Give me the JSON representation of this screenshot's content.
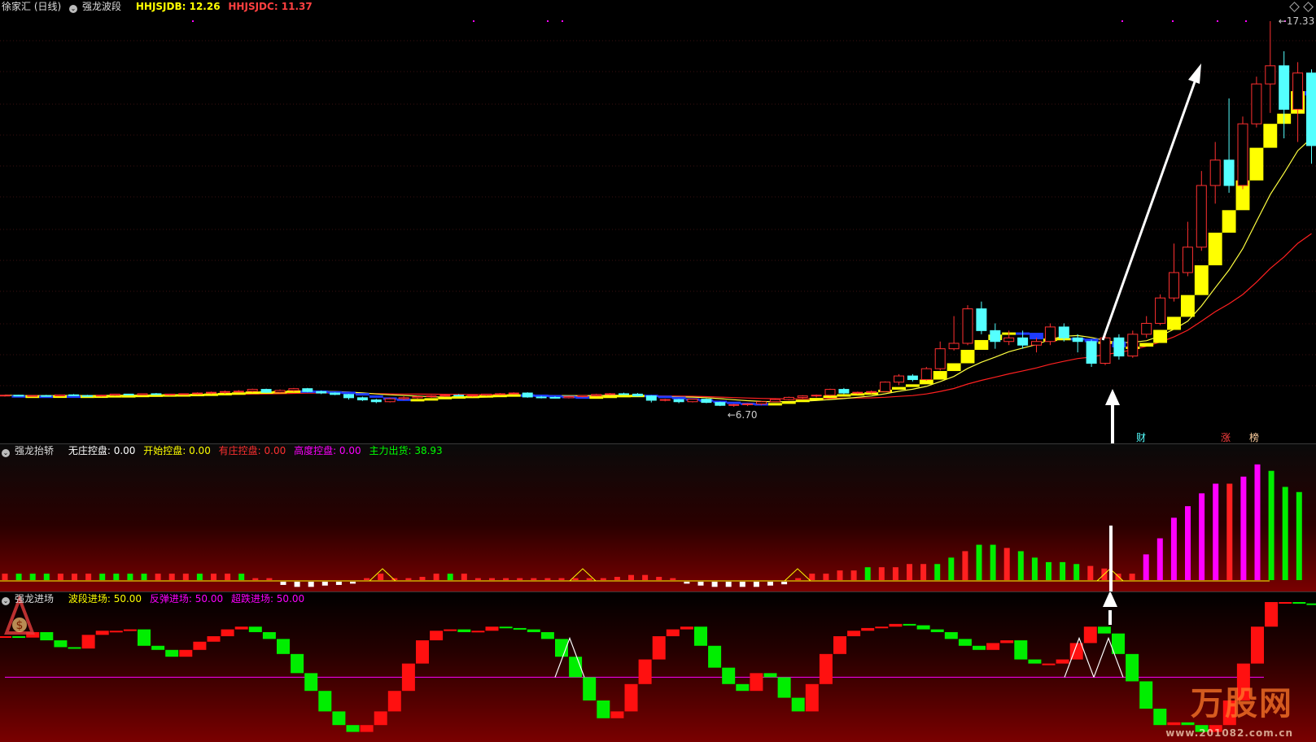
{
  "header_main": {
    "stock": "徐家汇 (日线)",
    "indicator": "强龙波段",
    "label1": "HHJSJDB: 12.26",
    "label2": "HHJSJDC: 11.37"
  },
  "header_p2": {
    "title": "强龙抬轿",
    "items": [
      "无庄控盘: 0.00",
      "开始控盘: 0.00",
      "有庄控盘: 0.00",
      "高度控盘: 0.00",
      "主力出货: 38.93"
    ]
  },
  "header_p3": {
    "title": "强龙进场",
    "items": [
      "波段进场: 50.00",
      "反弹进场: 50.00",
      "超跌进场: 50.00"
    ]
  },
  "markers": [
    "财",
    "涨",
    "榜"
  ],
  "watermark": {
    "brand": "万股网",
    "url": "www.201082.com.cn"
  },
  "colors": {
    "up": "#ff3030",
    "down": "#54ffff",
    "ma": "#ffff00",
    "magenta": "#ff00ff",
    "green": "#00ff00"
  },
  "chart_data": [
    {
      "type": "candlestick",
      "title": "强龙波段",
      "annotations": [
        {
          "text": "17.33",
          "kind": "max_price"
        },
        {
          "text": "6.70",
          "kind": "min_price"
        }
      ],
      "candles": [
        [
          7.0,
          7.03,
          6.98,
          7.02
        ],
        [
          7.02,
          7.03,
          6.99,
          7.0
        ],
        [
          7.0,
          7.02,
          6.99,
          7.01
        ],
        [
          7.01,
          7.03,
          6.98,
          7.0
        ],
        [
          7.0,
          7.04,
          6.99,
          7.03
        ],
        [
          7.03,
          7.05,
          7.0,
          7.01
        ],
        [
          7.01,
          7.03,
          6.98,
          7.0
        ],
        [
          7.0,
          7.03,
          6.98,
          7.02
        ],
        [
          7.02,
          7.06,
          7.0,
          7.05
        ],
        [
          7.05,
          7.06,
          7.02,
          7.03
        ],
        [
          7.03,
          7.07,
          7.02,
          7.06
        ],
        [
          7.06,
          7.08,
          7.03,
          7.04
        ],
        [
          7.04,
          7.06,
          7.01,
          7.05
        ],
        [
          7.05,
          7.07,
          7.03,
          7.06
        ],
        [
          7.06,
          7.1,
          7.04,
          7.08
        ],
        [
          7.08,
          7.12,
          7.05,
          7.1
        ],
        [
          7.1,
          7.15,
          7.06,
          7.12
        ],
        [
          7.12,
          7.16,
          7.1,
          7.13
        ],
        [
          7.13,
          7.2,
          7.1,
          7.18
        ],
        [
          7.18,
          7.2,
          7.08,
          7.1
        ],
        [
          7.1,
          7.18,
          7.08,
          7.15
        ],
        [
          7.15,
          7.22,
          7.12,
          7.2
        ],
        [
          7.2,
          7.22,
          7.1,
          7.12
        ],
        [
          7.12,
          7.15,
          7.05,
          7.08
        ],
        [
          7.08,
          7.1,
          7.02,
          7.04
        ],
        [
          7.04,
          7.06,
          6.9,
          6.95
        ],
        [
          6.95,
          6.98,
          6.86,
          6.89
        ],
        [
          6.89,
          6.92,
          6.8,
          6.84
        ],
        [
          6.84,
          6.95,
          6.82,
          6.92
        ],
        [
          6.92,
          6.99,
          6.88,
          6.95
        ],
        [
          6.95,
          7.0,
          6.92,
          6.98
        ],
        [
          6.98,
          7.02,
          6.95,
          7.0
        ],
        [
          7.0,
          7.04,
          6.97,
          7.02
        ],
        [
          7.02,
          7.05,
          6.99,
          7.01
        ],
        [
          7.01,
          7.03,
          6.98,
          7.02
        ],
        [
          7.02,
          7.06,
          7.0,
          7.05
        ],
        [
          7.05,
          7.08,
          7.02,
          7.06
        ],
        [
          7.06,
          7.1,
          7.04,
          7.08
        ],
        [
          7.08,
          7.1,
          6.95,
          6.97
        ],
        [
          6.97,
          7.0,
          6.93,
          6.96
        ],
        [
          6.96,
          6.99,
          6.93,
          6.95
        ],
        [
          6.95,
          7.0,
          6.93,
          6.98
        ],
        [
          6.98,
          7.02,
          6.96,
          7.01
        ],
        [
          7.01,
          7.06,
          6.99,
          7.04
        ],
        [
          7.04,
          7.08,
          7.02,
          7.06
        ],
        [
          7.06,
          7.09,
          7.03,
          7.05
        ],
        [
          7.05,
          7.08,
          6.98,
          7.0
        ],
        [
          7.0,
          7.02,
          6.82,
          6.88
        ],
        [
          6.88,
          6.92,
          6.85,
          6.9
        ],
        [
          6.9,
          6.92,
          6.8,
          6.84
        ],
        [
          6.84,
          6.92,
          6.82,
          6.91
        ],
        [
          6.91,
          6.93,
          6.8,
          6.82
        ],
        [
          6.82,
          6.84,
          6.72,
          6.74
        ],
        [
          6.74,
          6.78,
          6.7,
          6.76
        ],
        [
          6.76,
          6.8,
          6.72,
          6.78
        ],
        [
          6.78,
          6.86,
          6.74,
          6.84
        ],
        [
          6.84,
          6.92,
          6.82,
          6.9
        ],
        [
          6.9,
          6.98,
          6.88,
          6.96
        ],
        [
          6.96,
          7.02,
          6.93,
          7.0
        ],
        [
          7.0,
          7.04,
          6.96,
          7.02
        ],
        [
          7.02,
          7.2,
          7.0,
          7.18
        ],
        [
          7.18,
          7.22,
          7.05,
          7.08
        ],
        [
          7.08,
          7.12,
          7.05,
          7.1
        ],
        [
          7.1,
          7.15,
          7.06,
          7.12
        ],
        [
          7.12,
          7.4,
          7.1,
          7.38
        ],
        [
          7.38,
          7.6,
          7.3,
          7.55
        ],
        [
          7.55,
          7.6,
          7.4,
          7.45
        ],
        [
          7.45,
          7.8,
          7.42,
          7.75
        ],
        [
          7.75,
          8.5,
          7.7,
          8.3
        ],
        [
          8.3,
          9.2,
          8.25,
          8.45
        ],
        [
          8.45,
          9.5,
          8.4,
          9.4
        ],
        [
          9.4,
          9.6,
          8.7,
          8.8
        ],
        [
          8.8,
          9.0,
          8.3,
          8.5
        ],
        [
          8.5,
          8.8,
          8.4,
          8.6
        ],
        [
          8.6,
          8.8,
          8.3,
          8.4
        ],
        [
          8.4,
          8.6,
          8.2,
          8.5
        ],
        [
          8.5,
          9.0,
          8.4,
          8.9
        ],
        [
          8.9,
          9.0,
          8.5,
          8.6
        ],
        [
          8.6,
          8.7,
          8.2,
          8.5
        ],
        [
          8.5,
          8.55,
          7.8,
          7.9
        ],
        [
          7.9,
          8.7,
          7.85,
          8.6
        ],
        [
          8.6,
          8.7,
          8.0,
          8.1
        ],
        [
          8.1,
          8.8,
          8.05,
          8.7
        ],
        [
          8.7,
          9.2,
          8.6,
          9.0
        ],
        [
          9.0,
          9.8,
          8.95,
          9.7
        ],
        [
          9.7,
          11.2,
          9.6,
          10.4
        ],
        [
          10.4,
          11.8,
          10.3,
          11.1
        ],
        [
          11.1,
          13.2,
          11.0,
          12.8
        ],
        [
          12.8,
          14.0,
          12.3,
          13.5
        ],
        [
          13.5,
          15.2,
          12.6,
          12.8
        ],
        [
          12.8,
          14.7,
          12.7,
          14.5
        ],
        [
          14.5,
          15.8,
          14.4,
          15.6
        ],
        [
          15.6,
          17.33,
          14.8,
          16.1
        ],
        [
          16.1,
          16.5,
          14.1,
          14.9
        ],
        [
          14.9,
          16.2,
          14.0,
          15.9
        ],
        [
          15.9,
          16.0,
          13.4,
          13.9
        ]
      ],
      "ma_thin_yellow": [
        8.7,
        9.1,
        9.6,
        10.1,
        10.7,
        11.3,
        11.9,
        12.4,
        12.9,
        13.2
      ],
      "ma_thin_red": [
        8.4,
        8.55,
        8.8,
        9.1,
        9.5,
        9.9,
        10.4,
        10.9,
        11.5,
        12.0
      ]
    },
    {
      "type": "bar",
      "title": "强龙抬轿",
      "series": [
        {
          "name": "主力出货",
          "values": [
            38.93
          ]
        }
      ],
      "bars": [
        [
          1,
          "r"
        ],
        [
          1,
          "g"
        ],
        [
          1,
          "g"
        ],
        [
          1,
          "g"
        ],
        [
          1,
          "r"
        ],
        [
          1,
          "r"
        ],
        [
          1,
          "r"
        ],
        [
          1,
          "g"
        ],
        [
          1,
          "g"
        ],
        [
          1,
          "g"
        ],
        [
          1,
          "g"
        ],
        [
          1,
          "r"
        ],
        [
          1,
          "r"
        ],
        [
          1,
          "r"
        ],
        [
          1,
          "g"
        ],
        [
          1,
          "r"
        ],
        [
          1,
          "r"
        ],
        [
          1,
          "g"
        ],
        [
          0.3,
          "r"
        ],
        [
          0.3,
          "r"
        ],
        [
          -0.5,
          "w"
        ],
        [
          -0.8,
          "w"
        ],
        [
          -0.8,
          "w"
        ],
        [
          -0.6,
          "w"
        ],
        [
          -0.5,
          "w"
        ],
        [
          -0.3,
          "w"
        ],
        [
          0.3,
          "r"
        ],
        [
          1,
          "r"
        ],
        [
          0.3,
          "r"
        ],
        [
          0.3,
          "r"
        ],
        [
          0.5,
          "r"
        ],
        [
          1,
          "r"
        ],
        [
          1,
          "g"
        ],
        [
          1,
          "r"
        ],
        [
          0.3,
          "r"
        ],
        [
          0.3,
          "r"
        ],
        [
          0.3,
          "r"
        ],
        [
          0.3,
          "r"
        ],
        [
          0.3,
          "r"
        ],
        [
          0.3,
          "r"
        ],
        [
          0.3,
          "r"
        ],
        [
          0.3,
          "r"
        ],
        [
          0.3,
          "r"
        ],
        [
          0.3,
          "r"
        ],
        [
          0.5,
          "r"
        ],
        [
          0.8,
          "r"
        ],
        [
          0.8,
          "r"
        ],
        [
          0.5,
          "r"
        ],
        [
          0.3,
          "r"
        ],
        [
          -0.3,
          "w"
        ],
        [
          -0.6,
          "w"
        ],
        [
          -0.8,
          "w"
        ],
        [
          -0.8,
          "w"
        ],
        [
          -0.8,
          "w"
        ],
        [
          -0.8,
          "w"
        ],
        [
          -0.6,
          "w"
        ],
        [
          -0.4,
          "w"
        ],
        [
          0.3,
          "r"
        ],
        [
          1,
          "r"
        ],
        [
          1,
          "r"
        ],
        [
          1.5,
          "r"
        ],
        [
          1.5,
          "r"
        ],
        [
          2,
          "g"
        ],
        [
          2,
          "r"
        ],
        [
          2,
          "r"
        ],
        [
          2.5,
          "r"
        ],
        [
          2.5,
          "r"
        ],
        [
          2.5,
          "g"
        ],
        [
          3.5,
          "g"
        ],
        [
          4.5,
          "r"
        ],
        [
          5.5,
          "g"
        ],
        [
          5.5,
          "g"
        ],
        [
          5,
          "r"
        ],
        [
          4.5,
          "g"
        ],
        [
          3.5,
          "g"
        ],
        [
          2.8,
          "g"
        ],
        [
          2.8,
          "g"
        ],
        [
          2.5,
          "g"
        ],
        [
          2.2,
          "r"
        ],
        [
          1.8,
          "r"
        ],
        [
          1,
          "r"
        ],
        [
          1,
          "r"
        ],
        [
          4,
          "m"
        ],
        [
          6.5,
          "m"
        ],
        [
          9.7,
          "m"
        ],
        [
          11.5,
          "m"
        ],
        [
          13.5,
          "m"
        ],
        [
          15,
          "m"
        ],
        [
          15,
          "r"
        ],
        [
          16.1,
          "m"
        ],
        [
          18,
          "m"
        ],
        [
          17,
          "g"
        ],
        [
          14.5,
          "g"
        ],
        [
          13.7,
          "g"
        ]
      ]
    },
    {
      "type": "line",
      "title": "强龙进场",
      "series": [
        {
          "name": "波段进场",
          "values": [
            50.0
          ]
        },
        {
          "name": "反弹进场",
          "values": [
            50.0
          ]
        },
        {
          "name": "超跌进场",
          "values": [
            50.0
          ]
        }
      ],
      "values": [
        75,
        74,
        78,
        72,
        67,
        66,
        76,
        79,
        79,
        80,
        68,
        65,
        60,
        65,
        71,
        75,
        80,
        82,
        78,
        73,
        62,
        48,
        35,
        20,
        10,
        5,
        10,
        20,
        35,
        55,
        72,
        79,
        80,
        78,
        79,
        82,
        81,
        80,
        78,
        73,
        60,
        45,
        28,
        15,
        20,
        40,
        58,
        75,
        80,
        82,
        68,
        52,
        40,
        35,
        48,
        45,
        30,
        20,
        40,
        62,
        75,
        79,
        81,
        82,
        84,
        83,
        80,
        78,
        73,
        68,
        65,
        70,
        72,
        58,
        55,
        55,
        58,
        70,
        82,
        77,
        62,
        42,
        22,
        10,
        12,
        10,
        5,
        10,
        28,
        55,
        82,
        100,
        100,
        99,
        98,
        95,
        94,
        94,
        92,
        85
      ],
      "baseline": 45
    }
  ]
}
